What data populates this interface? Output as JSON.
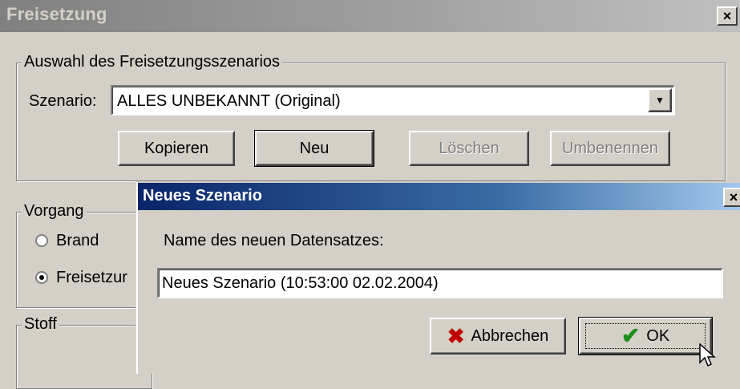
{
  "main_window": {
    "title": "Freisetzung",
    "close_label": "×",
    "group_scenario": {
      "legend": "Auswahl des Freisetzungsszenarios",
      "scenario_label": "Szenario:",
      "scenario_value": "ALLES UNBEKANNT (Original)",
      "buttons": {
        "copy": "Kopieren",
        "new": "Neu",
        "delete": "Löschen",
        "rename": "Umbenennen"
      }
    },
    "group_process": {
      "legend": "Vorgang",
      "options": [
        {
          "label": "Brand",
          "selected": false
        },
        {
          "label": "Freisetzur",
          "selected": true
        }
      ]
    },
    "group_substance": {
      "legend": "Stoff"
    }
  },
  "dialog": {
    "title": "Neues Szenario",
    "close_label": "×",
    "prompt": "Name des neuen Datensatzes:",
    "name_value": "Neues Szenario (10:53:00 02.02.2004)",
    "cancel_label": "Abbrechen",
    "ok_label": "OK",
    "cancel_icon": "red-x-icon",
    "ok_icon": "green-check-icon"
  },
  "colors": {
    "face": "#d4d0c8",
    "active_title": "#0a246a",
    "inactive_title": "#808080"
  }
}
